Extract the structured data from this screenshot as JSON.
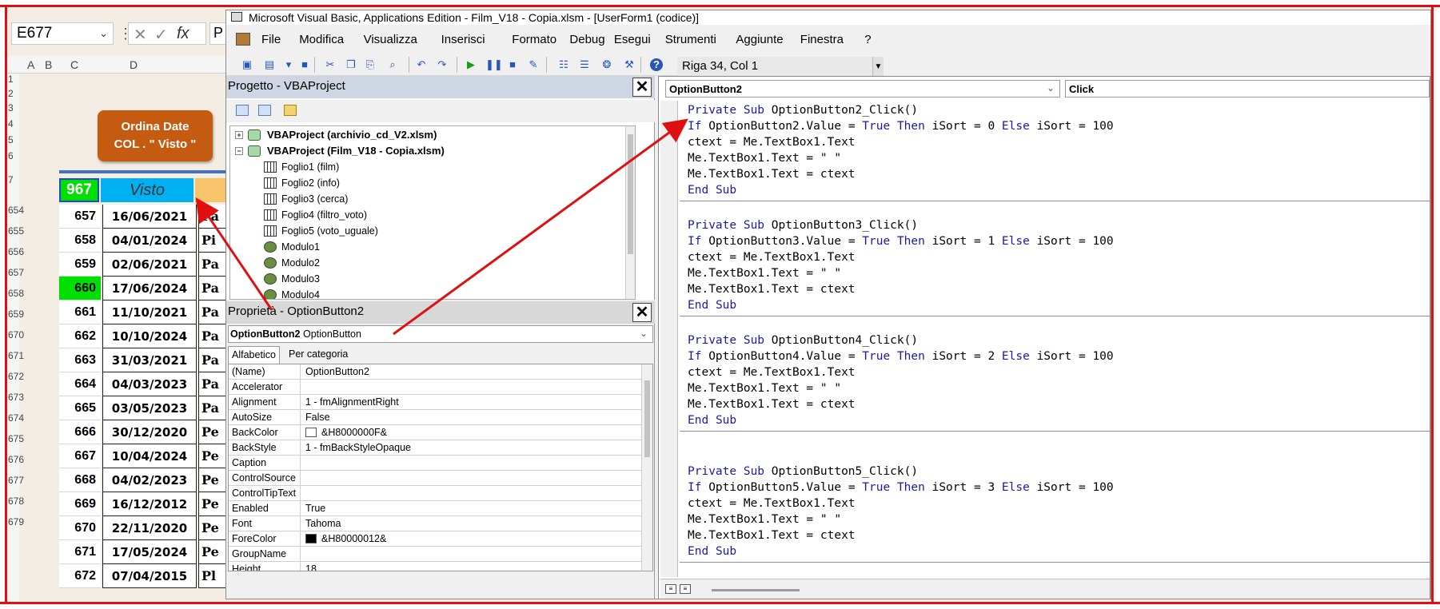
{
  "excel": {
    "name_box": "E677",
    "formula_prefix": "P",
    "columns": [
      "A",
      "B",
      "C",
      "D"
    ],
    "row_numbers": [
      "1",
      "2",
      "3",
      "4",
      "5",
      "6",
      "7",
      "654",
      "655",
      "656",
      "657",
      "658",
      "659",
      "670",
      "671",
      "672",
      "673",
      "674",
      "675",
      "676",
      "677",
      "678",
      "679"
    ],
    "order_button": [
      "Ordina Date",
      "COL . \" Visto \""
    ],
    "header_count": "967",
    "header_visto": "Visto",
    "rows": [
      {
        "num": "657",
        "date": "16/06/2021",
        "title": "Pa",
        "highlight": false
      },
      {
        "num": "658",
        "date": "04/01/2024",
        "title": "Pi",
        "highlight": false
      },
      {
        "num": "659",
        "date": "02/06/2021",
        "title": "Pa",
        "highlight": false
      },
      {
        "num": "660",
        "date": "17/06/2024",
        "title": "Pa",
        "highlight": true
      },
      {
        "num": "661",
        "date": "11/10/2021",
        "title": "Pa",
        "highlight": false
      },
      {
        "num": "662",
        "date": "10/10/2024",
        "title": "Pa",
        "highlight": false
      },
      {
        "num": "663",
        "date": "31/03/2021",
        "title": "Pa",
        "highlight": false
      },
      {
        "num": "664",
        "date": "04/03/2023",
        "title": "Pa",
        "highlight": false
      },
      {
        "num": "665",
        "date": "03/05/2023",
        "title": "Pa",
        "highlight": false
      },
      {
        "num": "666",
        "date": "30/12/2020",
        "title": "Pe",
        "highlight": false
      },
      {
        "num": "667",
        "date": "10/04/2024",
        "title": "Pe",
        "highlight": false
      },
      {
        "num": "668",
        "date": "04/02/2023",
        "title": "Pe",
        "highlight": false
      },
      {
        "num": "669",
        "date": "16/12/2012",
        "title": "Pe",
        "highlight": false
      },
      {
        "num": "670",
        "date": "22/11/2020",
        "title": "Pe",
        "highlight": false
      },
      {
        "num": "671",
        "date": "17/05/2024",
        "title": "Pe",
        "highlight": false
      },
      {
        "num": "672",
        "date": "07/04/2015",
        "title": "Pl",
        "highlight": false
      }
    ]
  },
  "vbe": {
    "title": "Microsoft Visual Basic, Applications Edition - Film_V18 - Copia.xlsm - [UserForm1 (codice)]",
    "menu": [
      "File",
      "Modifica",
      "Visualizza",
      "Inserisci",
      "Formato",
      "Debug",
      "Esegui",
      "Strumenti",
      "Aggiunte",
      "Finestra",
      "?"
    ],
    "position": "Riga 34, Col 1",
    "toolbar_icons": [
      "excel-icon",
      "insert-userform-icon",
      "dropdown-arrow-icon",
      "save-icon",
      "cut-icon",
      "copy-icon",
      "paste-icon",
      "find-icon",
      "undo-icon",
      "redo-icon",
      "run-icon",
      "pause-icon",
      "reset-icon",
      "design-mode-icon",
      "project-explorer-icon",
      "properties-icon",
      "object-browser-icon",
      "toolbox-icon",
      "help-icon"
    ]
  },
  "project": {
    "title": "Progetto - VBAProject",
    "nodes": [
      {
        "label": "VBAProject (archivio_cd_V2.xlsm)",
        "bold": true,
        "kind": "project",
        "expander": "+"
      },
      {
        "label": "VBAProject (Film_V18 - Copia.xlsm)",
        "bold": true,
        "kind": "project",
        "expander": "-"
      },
      {
        "label": "Foglio1 (film)",
        "bold": false,
        "kind": "sheet"
      },
      {
        "label": "Foglio2 (info)",
        "bold": false,
        "kind": "sheet"
      },
      {
        "label": "Foglio3 (cerca)",
        "bold": false,
        "kind": "sheet"
      },
      {
        "label": "Foglio4 (filtro_voto)",
        "bold": false,
        "kind": "sheet"
      },
      {
        "label": "Foglio5 (voto_uguale)",
        "bold": false,
        "kind": "sheet"
      },
      {
        "label": "Modulo1",
        "bold": false,
        "kind": "module"
      },
      {
        "label": "Modulo2",
        "bold": false,
        "kind": "module"
      },
      {
        "label": "Modulo3",
        "bold": false,
        "kind": "module"
      },
      {
        "label": "Modulo4",
        "bold": false,
        "kind": "module"
      }
    ]
  },
  "properties": {
    "title": "Proprietà - OptionButton2",
    "object_name": "OptionButton2",
    "object_type": "OptionButton",
    "tabs": [
      "Alfabetico",
      "Per categoria"
    ],
    "rows": [
      {
        "name": "(Name)",
        "value": "OptionButton2"
      },
      {
        "name": "Accelerator",
        "value": ""
      },
      {
        "name": "Alignment",
        "value": "1 - fmAlignmentRight"
      },
      {
        "name": "AutoSize",
        "value": "False"
      },
      {
        "name": "BackColor",
        "value": "&H8000000F&",
        "swatch": "#ffffff"
      },
      {
        "name": "BackStyle",
        "value": "1 - fmBackStyleOpaque"
      },
      {
        "name": "Caption",
        "value": ""
      },
      {
        "name": "ControlSource",
        "value": ""
      },
      {
        "name": "ControlTipText",
        "value": ""
      },
      {
        "name": "Enabled",
        "value": "True"
      },
      {
        "name": "Font",
        "value": "Tahoma"
      },
      {
        "name": "ForeColor",
        "value": "&H80000012&",
        "swatch": "#000000"
      },
      {
        "name": "GroupName",
        "value": ""
      },
      {
        "name": "Height",
        "value": "18"
      }
    ]
  },
  "code": {
    "object_combo": "OptionButton2",
    "proc_combo": "Click",
    "keyword_color": "#1a1aa6",
    "procedures": [
      {
        "lines": [
          "Private Sub OptionButton2_Click()",
          "If OptionButton2.Value = True Then iSort = 0 Else iSort = 100",
          "ctext = Me.TextBox1.Text",
          "Me.TextBox1.Text = \" \"",
          "Me.TextBox1.Text = ctext",
          "End Sub"
        ],
        "lead_blank": 0
      },
      {
        "lines": [
          "Private Sub OptionButton3_Click()",
          "If OptionButton3.Value = True Then iSort = 1 Else iSort = 100",
          "ctext = Me.TextBox1.Text",
          "Me.TextBox1.Text = \" \"",
          "Me.TextBox1.Text = ctext",
          "End Sub"
        ],
        "lead_blank": 1
      },
      {
        "lines": [
          "Private Sub OptionButton4_Click()",
          "If OptionButton4.Value = True Then iSort = 2 Else iSort = 100",
          "ctext = Me.TextBox1.Text",
          "Me.TextBox1.Text = \" \"",
          "Me.TextBox1.Text = ctext",
          "End Sub"
        ],
        "lead_blank": 1
      },
      {
        "lines": [
          "Private Sub OptionButton5_Click()",
          "If OptionButton5.Value = True Then iSort = 3 Else iSort = 100",
          "ctext = Me.TextBox1.Text",
          "Me.TextBox1.Text = \" \"",
          "Me.TextBox1.Text = ctext",
          "End Sub"
        ],
        "lead_blank": 2
      }
    ]
  },
  "annotation_color": "#e01010"
}
